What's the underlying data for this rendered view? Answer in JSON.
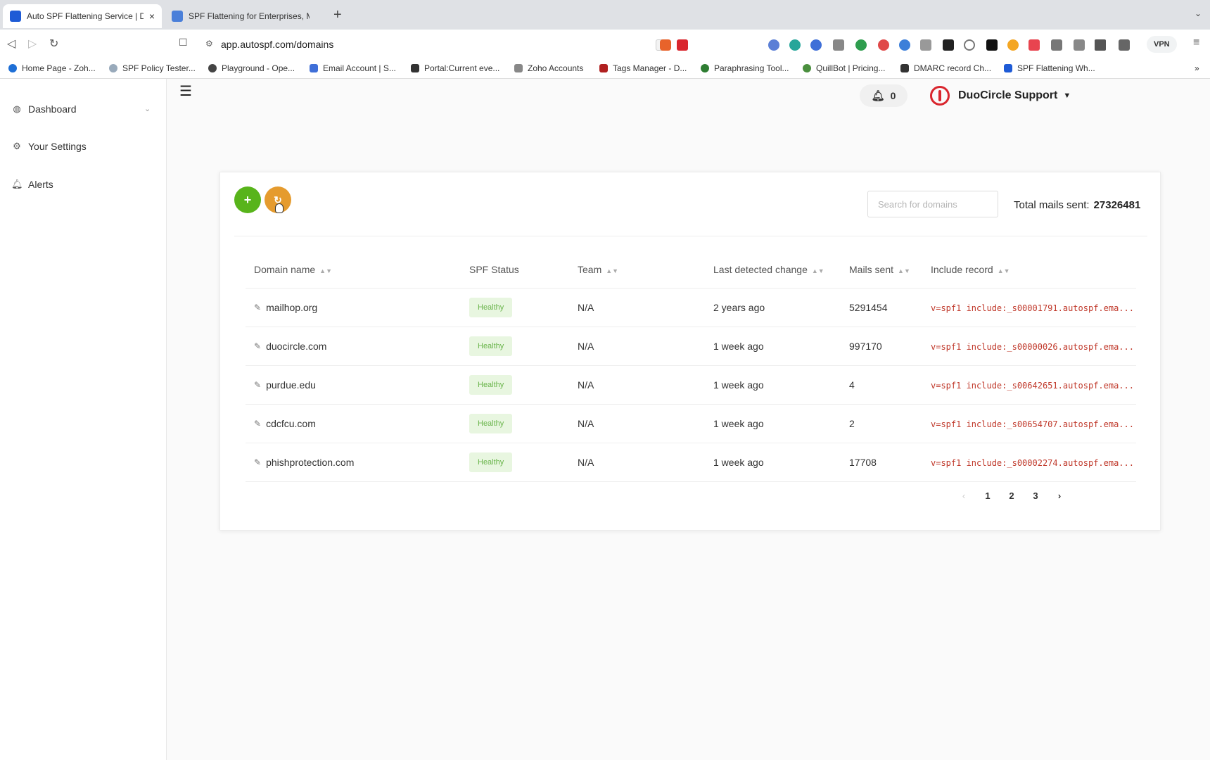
{
  "browser": {
    "tabs": [
      {
        "title": "Auto SPF Flattening Service | D",
        "active": true
      },
      {
        "title": "SPF Flattening for Enterprises, MSP",
        "active": false
      }
    ],
    "url": "app.autospf.com/domains",
    "vpn_label": "VPN",
    "bookmarks": [
      "Home Page - Zoh...",
      "SPF Policy Tester...",
      "Playground - Ope...",
      "Email Account | S...",
      "Portal:Current eve...",
      "Zoho Accounts",
      "Tags Manager - D...",
      "Paraphrasing Tool...",
      "QuillBot | Pricing...",
      "DMARC record Ch...",
      "SPF Flattening Wh..."
    ]
  },
  "sidebar": {
    "items": [
      {
        "label": "Dashboard",
        "icon": "dashboard-icon"
      },
      {
        "label": "Your Settings",
        "icon": "gear-icon"
      },
      {
        "label": "Alerts",
        "icon": "bell-icon"
      }
    ]
  },
  "header": {
    "notification_count": "0",
    "user_name": "DuoCircle Support"
  },
  "domains": {
    "search_placeholder": "Search for domains",
    "total_label": "Total mails sent:",
    "total_value": "27326481",
    "columns": [
      "Domain name",
      "SPF Status",
      "Team",
      "Last detected change",
      "Mails sent",
      "Include record"
    ],
    "rows": [
      {
        "domain": "mailhop.org",
        "status": "Healthy",
        "team": "N/A",
        "change": "2 years ago",
        "mails": "5291454",
        "record": "v=spf1 include:_s00001791.autospf.ema..."
      },
      {
        "domain": "duocircle.com",
        "status": "Healthy",
        "team": "N/A",
        "change": "1 week ago",
        "mails": "997170",
        "record": "v=spf1 include:_s00000026.autospf.ema..."
      },
      {
        "domain": "purdue.edu",
        "status": "Healthy",
        "team": "N/A",
        "change": "1 week ago",
        "mails": "4",
        "record": "v=spf1 include:_s00642651.autospf.ema..."
      },
      {
        "domain": "cdcfcu.com",
        "status": "Healthy",
        "team": "N/A",
        "change": "1 week ago",
        "mails": "2",
        "record": "v=spf1 include:_s00654707.autospf.ema..."
      },
      {
        "domain": "phishprotection.com",
        "status": "Healthy",
        "team": "N/A",
        "change": "1 week ago",
        "mails": "17708",
        "record": "v=spf1 include:_s00002274.autospf.ema..."
      }
    ],
    "pages": [
      "1",
      "2",
      "3"
    ]
  },
  "colors": {
    "add_button": "#58b41b",
    "refresh_button": "#e59b2e",
    "healthy_badge_bg": "#e8f6e0",
    "healthy_badge_text": "#6ab54b",
    "record_text": "#c0392b",
    "logo_red": "#d9262e"
  }
}
